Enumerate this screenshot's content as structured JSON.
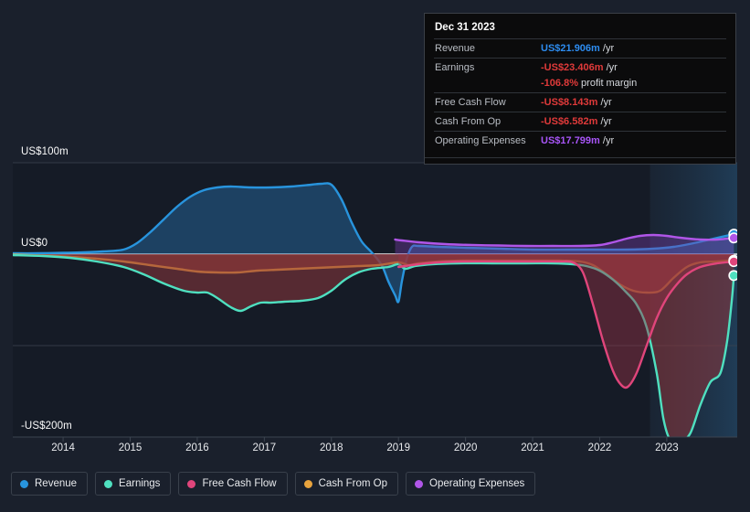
{
  "tooltip": {
    "date": "Dec 31 2023",
    "rows": [
      {
        "key": "Revenue",
        "value": "US$21.906m",
        "unit": "/yr",
        "color": "#2d8cf0"
      },
      {
        "key": "Earnings",
        "value": "-US$23.406m",
        "unit": "/yr",
        "color": "#e03a3a"
      },
      {
        "key": "",
        "value": "-106.8%",
        "unit": "profit margin",
        "color": "#e03a3a"
      },
      {
        "key": "Free Cash Flow",
        "value": "-US$8.143m",
        "unit": "/yr",
        "color": "#e03a3a"
      },
      {
        "key": "Cash From Op",
        "value": "-US$6.582m",
        "unit": "/yr",
        "color": "#e03a3a"
      },
      {
        "key": "Operating Expenses",
        "value": "US$17.799m",
        "unit": "/yr",
        "color": "#a855f7"
      }
    ]
  },
  "legend": {
    "items": [
      {
        "label": "Revenue",
        "color": "#2894dd"
      },
      {
        "label": "Earnings",
        "color": "#4fe0c0"
      },
      {
        "label": "Free Cash Flow",
        "color": "#e0457b"
      },
      {
        "label": "Cash From Op",
        "color": "#e8a33d"
      },
      {
        "label": "Operating Expenses",
        "color": "#b056e8"
      }
    ]
  },
  "axes": {
    "y_ticks": [
      {
        "label": "US$100m",
        "value": 100
      },
      {
        "label": "US$0",
        "value": 0
      },
      {
        "label": "-US$200m",
        "value": -200
      }
    ],
    "x_ticks": [
      "2014",
      "2015",
      "2016",
      "2017",
      "2018",
      "2019",
      "2020",
      "2021",
      "2022",
      "2023"
    ]
  },
  "chart_data": {
    "type": "area",
    "title": "",
    "xlabel": "",
    "ylabel": "US$",
    "ylim": [
      -210,
      100
    ],
    "xlim": [
      2013.25,
      2024.05
    ],
    "grid": true,
    "legend_position": "bottom",
    "gridlines": [
      100,
      0,
      -100
    ],
    "highlight_band": {
      "from": 2022.75,
      "to": 2024.05,
      "label": "forecast"
    },
    "units": "US$m",
    "series": [
      {
        "name": "Revenue",
        "color": "#2894dd",
        "fill": "rgba(40,120,180,0.42)",
        "end_value": 21.906,
        "points": [
          [
            2013.25,
            1
          ],
          [
            2013.6,
            1
          ],
          [
            2014.0,
            1.5
          ],
          [
            2014.3,
            2
          ],
          [
            2014.6,
            3
          ],
          [
            2014.9,
            5
          ],
          [
            2015.1,
            12
          ],
          [
            2015.3,
            24
          ],
          [
            2015.5,
            38
          ],
          [
            2015.7,
            52
          ],
          [
            2015.9,
            63
          ],
          [
            2016.1,
            70
          ],
          [
            2016.3,
            73
          ],
          [
            2016.5,
            74
          ],
          [
            2016.8,
            73
          ],
          [
            2017.1,
            73
          ],
          [
            2017.4,
            74
          ],
          [
            2017.7,
            76
          ],
          [
            2017.85,
            77
          ],
          [
            2018.0,
            76
          ],
          [
            2018.15,
            60
          ],
          [
            2018.3,
            35
          ],
          [
            2018.45,
            14
          ],
          [
            2018.6,
            2
          ],
          [
            2018.75,
            -12
          ],
          [
            2018.85,
            -30
          ],
          [
            2018.95,
            -45
          ],
          [
            2019.0,
            -52
          ],
          [
            2019.05,
            -30
          ],
          [
            2019.12,
            -6
          ],
          [
            2019.2,
            8
          ],
          [
            2019.3,
            9
          ],
          [
            2019.6,
            8
          ],
          [
            2020.0,
            7
          ],
          [
            2020.5,
            6
          ],
          [
            2021.0,
            5
          ],
          [
            2021.5,
            5
          ],
          [
            2022.0,
            5
          ],
          [
            2022.4,
            5
          ],
          [
            2022.8,
            6
          ],
          [
            2023.1,
            8
          ],
          [
            2023.4,
            12
          ],
          [
            2023.7,
            17
          ],
          [
            2024.0,
            21.9
          ]
        ]
      },
      {
        "name": "Operating Expenses",
        "color": "#b056e8",
        "fill": "rgba(120,60,170,0.40)",
        "end_value": 17.799,
        "points": [
          [
            2018.95,
            16
          ],
          [
            2019.05,
            15
          ],
          [
            2019.3,
            13
          ],
          [
            2019.7,
            11
          ],
          [
            2020.1,
            10
          ],
          [
            2020.5,
            9.5
          ],
          [
            2020.9,
            9
          ],
          [
            2021.3,
            9
          ],
          [
            2021.7,
            9
          ],
          [
            2022.0,
            10
          ],
          [
            2022.2,
            13
          ],
          [
            2022.4,
            17
          ],
          [
            2022.6,
            20
          ],
          [
            2022.8,
            21
          ],
          [
            2023.0,
            20
          ],
          [
            2023.2,
            18
          ],
          [
            2023.5,
            16
          ],
          [
            2023.75,
            16
          ],
          [
            2024.0,
            17.8
          ]
        ]
      },
      {
        "name": "Cash From Op",
        "color": "#e8a33d",
        "fill": "rgba(150,60,55,0.62)",
        "end_value": -6.582,
        "points": [
          [
            2013.25,
            -0.5
          ],
          [
            2013.7,
            -1.5
          ],
          [
            2014.1,
            -3
          ],
          [
            2014.5,
            -5
          ],
          [
            2014.9,
            -8
          ],
          [
            2015.3,
            -12
          ],
          [
            2015.7,
            -16
          ],
          [
            2016.0,
            -19
          ],
          [
            2016.3,
            -20
          ],
          [
            2016.6,
            -20
          ],
          [
            2016.9,
            -18
          ],
          [
            2017.2,
            -17
          ],
          [
            2017.5,
            -16
          ],
          [
            2017.8,
            -15
          ],
          [
            2018.1,
            -14
          ],
          [
            2018.4,
            -13
          ],
          [
            2018.7,
            -12
          ],
          [
            2019.0,
            -9
          ],
          [
            2019.15,
            -12
          ],
          [
            2019.3,
            -10
          ],
          [
            2019.6,
            -8
          ],
          [
            2020.0,
            -7
          ],
          [
            2020.5,
            -7
          ],
          [
            2021.0,
            -7
          ],
          [
            2021.4,
            -7
          ],
          [
            2021.7,
            -8
          ],
          [
            2021.9,
            -12
          ],
          [
            2022.1,
            -22
          ],
          [
            2022.3,
            -33
          ],
          [
            2022.5,
            -40
          ],
          [
            2022.7,
            -42
          ],
          [
            2022.9,
            -40
          ],
          [
            2023.1,
            -26
          ],
          [
            2023.3,
            -14
          ],
          [
            2023.5,
            -9
          ],
          [
            2023.75,
            -8
          ],
          [
            2024.0,
            -6.6
          ]
        ]
      },
      {
        "name": "Earnings",
        "color": "#4fe0c0",
        "fill": "rgba(140,55,60,0.55)",
        "end_value": -23.406,
        "points": [
          [
            2013.25,
            -1
          ],
          [
            2013.7,
            -2
          ],
          [
            2014.1,
            -4
          ],
          [
            2014.5,
            -8
          ],
          [
            2014.9,
            -14
          ],
          [
            2015.2,
            -22
          ],
          [
            2015.5,
            -32
          ],
          [
            2015.8,
            -40
          ],
          [
            2016.0,
            -42
          ],
          [
            2016.15,
            -42
          ],
          [
            2016.3,
            -48
          ],
          [
            2016.5,
            -58
          ],
          [
            2016.65,
            -62
          ],
          [
            2016.8,
            -57
          ],
          [
            2016.95,
            -53
          ],
          [
            2017.1,
            -53
          ],
          [
            2017.3,
            -52
          ],
          [
            2017.55,
            -51
          ],
          [
            2017.8,
            -48
          ],
          [
            2018.0,
            -40
          ],
          [
            2018.2,
            -28
          ],
          [
            2018.4,
            -20
          ],
          [
            2018.6,
            -16
          ],
          [
            2018.85,
            -14
          ],
          [
            2019.0,
            -11
          ],
          [
            2019.1,
            -16
          ],
          [
            2019.25,
            -13
          ],
          [
            2019.5,
            -11
          ],
          [
            2019.9,
            -10
          ],
          [
            2020.4,
            -10
          ],
          [
            2020.9,
            -10
          ],
          [
            2021.3,
            -10
          ],
          [
            2021.6,
            -11
          ],
          [
            2021.8,
            -13
          ],
          [
            2022.0,
            -18
          ],
          [
            2022.2,
            -28
          ],
          [
            2022.4,
            -42
          ],
          [
            2022.55,
            -55
          ],
          [
            2022.7,
            -80
          ],
          [
            2022.85,
            -130
          ],
          [
            2022.95,
            -180
          ],
          [
            2023.05,
            -203
          ],
          [
            2023.2,
            -205
          ],
          [
            2023.35,
            -196
          ],
          [
            2023.5,
            -165
          ],
          [
            2023.65,
            -140
          ],
          [
            2023.8,
            -130
          ],
          [
            2023.9,
            -95
          ],
          [
            2023.97,
            -50
          ],
          [
            2024.0,
            -23.4
          ]
        ]
      },
      {
        "name": "Free Cash Flow",
        "color": "#e0457b",
        "fill": "rgba(150,50,70,0.45)",
        "end_value": -8.143,
        "points": [
          [
            2019.0,
            -14
          ],
          [
            2019.1,
            -13
          ],
          [
            2019.3,
            -11
          ],
          [
            2019.6,
            -9
          ],
          [
            2020.0,
            -8
          ],
          [
            2020.5,
            -8
          ],
          [
            2021.0,
            -8
          ],
          [
            2021.4,
            -8
          ],
          [
            2021.6,
            -9
          ],
          [
            2021.75,
            -20
          ],
          [
            2021.9,
            -55
          ],
          [
            2022.05,
            -95
          ],
          [
            2022.2,
            -128
          ],
          [
            2022.32,
            -143
          ],
          [
            2022.42,
            -145
          ],
          [
            2022.55,
            -130
          ],
          [
            2022.7,
            -100
          ],
          [
            2022.85,
            -70
          ],
          [
            2023.0,
            -48
          ],
          [
            2023.15,
            -33
          ],
          [
            2023.3,
            -22
          ],
          [
            2023.5,
            -14
          ],
          [
            2023.75,
            -10
          ],
          [
            2024.0,
            -8.1
          ]
        ]
      }
    ]
  }
}
